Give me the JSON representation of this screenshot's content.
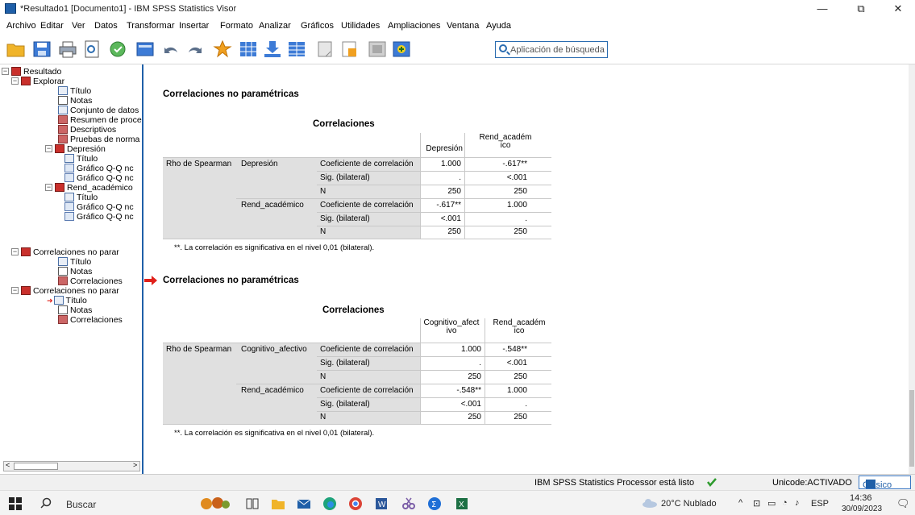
{
  "window": {
    "title": "*Resultado1 [Documento1] - IBM SPSS Statistics Visor",
    "minimize": "—",
    "maximize": "⧉",
    "close": "✕"
  },
  "menu": [
    "Archivo",
    "Editar",
    "Ver",
    "Datos",
    "Transformar",
    "Insertar",
    "Formato",
    "Analizar",
    "Gráficos",
    "Utilidades",
    "Ampliaciones",
    "Ventana",
    "Ayuda"
  ],
  "toolbar": {
    "search_placeholder": "Aplicación de búsqueda"
  },
  "outline": {
    "items": [
      {
        "label": "Resultado",
        "icon": "book-icon"
      },
      {
        "label": "Explorar",
        "icon": "book-icon"
      },
      {
        "label": "Título",
        "icon": "page-icon"
      },
      {
        "label": "Notas",
        "icon": "notes-icon"
      },
      {
        "label": "Conjunto de datos",
        "icon": "page-icon"
      },
      {
        "label": "Resumen de proce",
        "icon": "table-icon"
      },
      {
        "label": "Descriptivos",
        "icon": "table-icon"
      },
      {
        "label": "Pruebas de norma",
        "icon": "table-icon"
      },
      {
        "label": "Depresión",
        "icon": "book-icon"
      },
      {
        "label": "Título",
        "icon": "page-icon"
      },
      {
        "label": "Gráfico Q-Q nc",
        "icon": "chart-icon"
      },
      {
        "label": "Gráfico Q-Q nc",
        "icon": "chart-icon"
      },
      {
        "label": "Rend_académico",
        "icon": "book-icon"
      },
      {
        "label": "Título",
        "icon": "page-icon"
      },
      {
        "label": "Gráfico Q-Q nc",
        "icon": "chart-icon"
      },
      {
        "label": "Gráfico Q-Q nc",
        "icon": "chart-icon"
      },
      {
        "label": "Correlaciones no parar",
        "icon": "book-icon"
      },
      {
        "label": "Título",
        "icon": "page-icon"
      },
      {
        "label": "Notas",
        "icon": "notes-icon"
      },
      {
        "label": "Correlaciones",
        "icon": "table-icon"
      },
      {
        "label": "Correlaciones no parar",
        "icon": "book-icon"
      },
      {
        "label": "Título",
        "icon": "page-icon"
      },
      {
        "label": "Notas",
        "icon": "notes-icon"
      },
      {
        "label": "Correlaciones",
        "icon": "table-icon"
      }
    ],
    "scroll_left": "<",
    "scroll_right": ">"
  },
  "sections": [
    {
      "heading": "Correlaciones no paramétricas",
      "table_title": "Correlaciones",
      "col1": "Depresión",
      "col2a": "Rend_académ",
      "col2b": "ico",
      "row_header": "Rho de Spearman",
      "var1": "Depresión",
      "var2": "Rend_académico",
      "stat1": "Coeficiente de correlación",
      "stat2": "Sig. (bilateral)",
      "stat3": "N",
      "r1": [
        "1.000",
        "-.617**"
      ],
      "r2": [
        ".",
        "<.001"
      ],
      "r3": [
        "250",
        "250"
      ],
      "r4": [
        "-.617**",
        "1.000"
      ],
      "r5": [
        "<.001",
        "."
      ],
      "r6": [
        "250",
        "250"
      ],
      "footnote": "**. La correlación es significativa en el nivel 0,01 (bilateral)."
    },
    {
      "heading": "Correlaciones no paramétricas",
      "table_title": "Correlaciones",
      "col1a": "Cognitivo_afect",
      "col1b": "ivo",
      "col2a": "Rend_académ",
      "col2b": "ico",
      "row_header": "Rho de Spearman",
      "var1": "Cognitivo_afectivo",
      "var2": "Rend_académico",
      "stat1": "Coeficiente de correlación",
      "stat2": "Sig. (bilateral)",
      "stat3": "N",
      "r1": [
        "1.000",
        "-.548**"
      ],
      "r2": [
        ".",
        "<.001"
      ],
      "r3": [
        "250",
        "250"
      ],
      "r4": [
        "-.548**",
        "1.000"
      ],
      "r5": [
        "<.001",
        "."
      ],
      "r6": [
        "250",
        "250"
      ],
      "footnote": "**. La correlación es significativa en el nivel 0,01 (bilateral)."
    }
  ],
  "statusbar": {
    "processor": "IBM SPSS Statistics Processor está listo",
    "unicode": "Unicode:ACTIVADO",
    "mode": "Clásico"
  },
  "taskbar": {
    "search": "Buscar",
    "weather": "20°C Nublado",
    "lang": "ESP",
    "time": "14:36",
    "date": "30/09/2023"
  },
  "colors": {
    "accent": "#1f5fa8",
    "arrow": "#e0211b",
    "table_gray": "#e0e0e0"
  }
}
